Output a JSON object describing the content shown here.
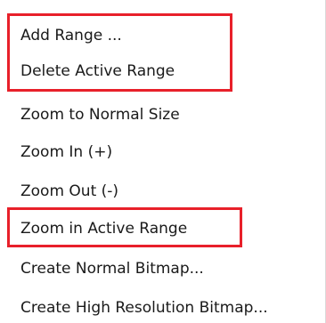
{
  "menu": {
    "items": [
      {
        "label": "Add Range ...",
        "highlighted": true,
        "highlight_group": 1
      },
      {
        "label": "Delete Active Range",
        "highlighted": true,
        "highlight_group": 1
      },
      {
        "label": "Zoom to Normal Size",
        "highlighted": false
      },
      {
        "label": "Zoom In (+)",
        "highlighted": false
      },
      {
        "label": "Zoom Out (-)",
        "highlighted": false
      },
      {
        "label": "Zoom in Active Range",
        "highlighted": true,
        "highlight_group": 2
      },
      {
        "label": "Create Normal Bitmap...",
        "highlighted": false
      },
      {
        "label": "Create High Resolution Bitmap...",
        "highlighted": false
      }
    ]
  },
  "colors": {
    "highlight_border": "#e8202a",
    "text": "#1a1a1a",
    "background": "#ffffff"
  }
}
